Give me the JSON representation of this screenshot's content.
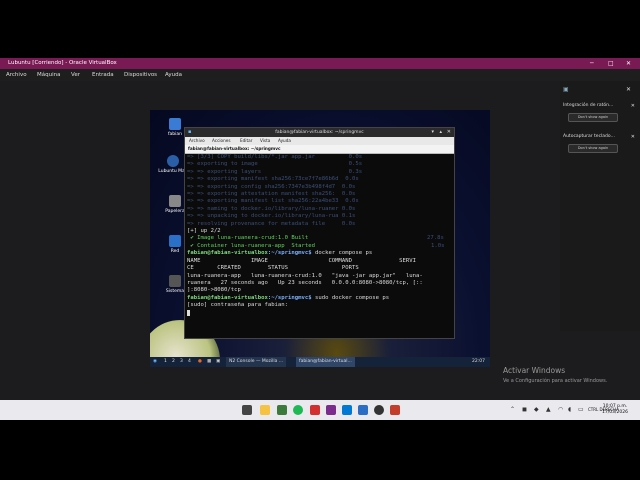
{
  "vbox": {
    "title": "Lubuntu [Corriendo] - Oracle VirtualBox",
    "menu": [
      "Archivo",
      "Máquina",
      "Ver",
      "Entrada",
      "Dispositivos",
      "Ayuda"
    ]
  },
  "notifications": {
    "items": [
      {
        "title": "Integración de ratón...",
        "button": "Don't show again"
      },
      {
        "title": "Autocapturar teclado...",
        "button": "Don't show again"
      }
    ]
  },
  "activation": {
    "title": "Activar Windows",
    "subtitle": "Ve a Configuración para activar Windows."
  },
  "desktop_icons": [
    {
      "label": "fabian",
      "color": "#3a7bd5"
    },
    {
      "label": "Lubuntu Man",
      "color": "#2a5fa8"
    },
    {
      "label": "Papelera",
      "color": "#888888"
    },
    {
      "label": "Red",
      "color": "#2a6fc8"
    },
    {
      "label": "Sistema",
      "color": "#555555"
    }
  ],
  "terminal": {
    "title": "fabian@fabian-virtualbox: ~/springmvc",
    "menu": [
      "Archivo",
      "Acciones",
      "Editar",
      "Vista",
      "Ayuda"
    ],
    "tab": "fabian@fabian-virtualbox: ~/springmvc",
    "faded_lines": [
      "=> [3/3] COPY build/libs/*.jar app.jar          0.0s",
      "=> exporting to image                           0.5s",
      "=> => exporting layers                          0.3s",
      "=> => exporting manifest sha256:73ce7f7e86b6d  0.0s",
      "=> => exporting config sha256:7347e3b498f4d7  0.0s",
      "=> => exporting attestation manifest sha256:  0.0s",
      "=> => exporting manifest list sha256:22a4be33  0.0s",
      "=> => naming to docker.io/library/luna-ruaner 0.0s",
      "=> => unpacking to docker.io/library/luna-rua 0.1s",
      "=> resolving provenance for metadata file     0.0s"
    ],
    "up_line": "[+] up 2/2",
    "image_line": " ✔ Image luna-ruanera-crud:1.0 Built",
    "image_time": "27.8s",
    "container_line": " ✔ Container luna-ruanera-app  Started",
    "container_time": "1.0s",
    "prompt_user": "fabian@fabian-virtualbox",
    "prompt_path": ":~/springmvc$",
    "cmd1": " docker compose ps",
    "ps_header1": "NAME               IMAGE                  COMMAND              SERVI",
    "ps_header2": "CE       CREATED        STATUS                PORTS",
    "ps_row1": "luna-ruanera-app   luna-ruanera-crud:1.0   \"java -jar app.jar\"   luna-",
    "ps_row2": "ruanera   27 seconds ago   Up 23 seconds   0.0.0.0:8080->8080/tcp, [::",
    "ps_row3": "]:8080->8080/tcp",
    "cmd2": " sudo docker compose ps",
    "sudo_prompt": "[sudo] contraseña para fabian:"
  },
  "guest_taskbar": {
    "workspaces": [
      "1",
      "2",
      "3",
      "4"
    ],
    "tasks": [
      "N2 Console — Mozilla ...",
      "fabian@fabian-virtual..."
    ],
    "time": "22:07"
  },
  "host_taskbar": {
    "lang": "CTRL DERECHA",
    "time": "10:07 p.m.",
    "date": "17/03/2026"
  }
}
